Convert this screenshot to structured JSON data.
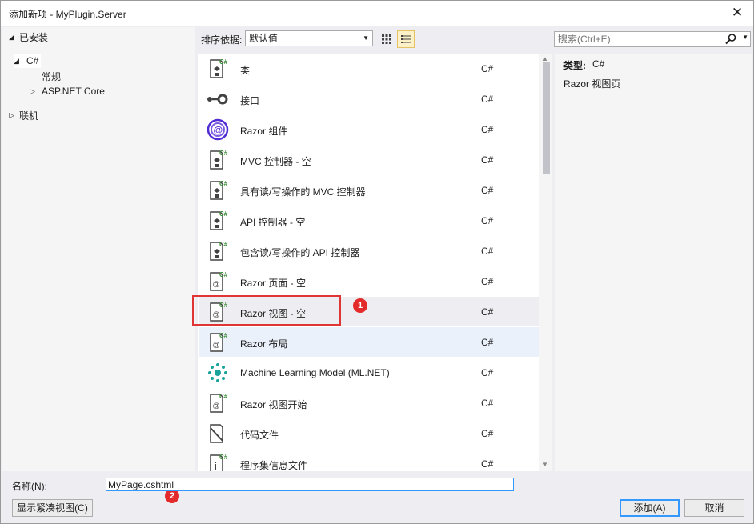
{
  "window": {
    "title": "添加新项 - MyPlugin.Server",
    "close_glyph": "✕"
  },
  "tree": {
    "installed": "已安装",
    "csharp": "C#",
    "general": "常规",
    "aspnet_core": "ASP.NET Core",
    "online": "联机"
  },
  "toolbar": {
    "sort_label": "排序依据:",
    "sort_value": "默认值",
    "search_placeholder": "搜索(Ctrl+E)"
  },
  "templates": [
    {
      "name": "类",
      "lang": "C#",
      "icon": "csharp-file-icon"
    },
    {
      "name": "接口",
      "lang": "C#",
      "icon": "interface-icon"
    },
    {
      "name": "Razor 组件",
      "lang": "C#",
      "icon": "blazor-icon"
    },
    {
      "name": "MVC 控制器 - 空",
      "lang": "C#",
      "icon": "csharp-file-icon"
    },
    {
      "name": "具有读/写操作的 MVC 控制器",
      "lang": "C#",
      "icon": "csharp-file-icon"
    },
    {
      "name": "API 控制器 - 空",
      "lang": "C#",
      "icon": "csharp-file-icon"
    },
    {
      "name": "包含读/写操作的 API 控制器",
      "lang": "C#",
      "icon": "csharp-file-icon"
    },
    {
      "name": "Razor 页面 - 空",
      "lang": "C#",
      "icon": "razor-file-icon"
    },
    {
      "name": "Razor 视图 - 空",
      "lang": "C#",
      "icon": "razor-file-icon"
    },
    {
      "name": "Razor 布局",
      "lang": "C#",
      "icon": "razor-file-icon"
    },
    {
      "name": "Machine Learning Model (ML.NET)",
      "lang": "C#",
      "icon": "ml-model-icon"
    },
    {
      "name": "Razor 视图开始",
      "lang": "C#",
      "icon": "razor-file-icon"
    },
    {
      "name": "代码文件",
      "lang": "C#",
      "icon": "code-file-icon"
    },
    {
      "name": "程序集信息文件",
      "lang": "C#",
      "icon": "assembly-info-icon"
    }
  ],
  "details": {
    "type_label": "类型:",
    "type_value": "C#",
    "description": "Razor 视图页"
  },
  "annotations": {
    "badge1": "1",
    "badge2": "2",
    "highlight_color": "#e03535"
  },
  "bottom": {
    "name_label": "名称(N):",
    "name_value": "MyPage.cshtml",
    "compact_view_button": "显示紧凑视图(C)",
    "add_button": "添加(A)",
    "cancel_button": "取消"
  },
  "colors": {
    "accent": "#3399ff",
    "csharp_green": "#388a34",
    "blazor_purple": "#512bd4",
    "ml_teal": "#1aa39a"
  }
}
